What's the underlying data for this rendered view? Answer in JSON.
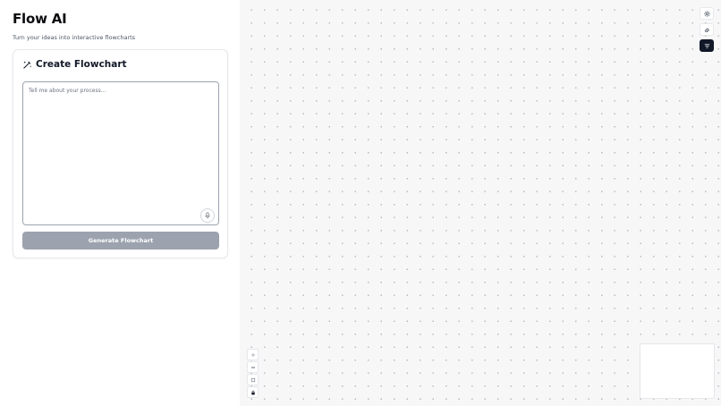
{
  "app": {
    "title": "Flow AI",
    "subtitle": "Turn your ideas into interactive flowcharts"
  },
  "create_card": {
    "title": "Create Flowchart",
    "prompt_placeholder": "Tell me about your process...",
    "generate_label": "Generate Flowchart"
  },
  "canvas": {
    "tools": [
      {
        "icon": "sun-icon",
        "active": false
      },
      {
        "icon": "eraser-icon",
        "active": false
      },
      {
        "icon": "filter-icon",
        "active": true
      }
    ],
    "zoom_controls": [
      "zoom-in-icon",
      "zoom-out-icon",
      "fit-view-icon",
      "lock-icon"
    ]
  },
  "colors": {
    "primary_dark": "#111827",
    "button_disabled": "#9ca3af",
    "canvas_bg": "#f7f7f8"
  }
}
